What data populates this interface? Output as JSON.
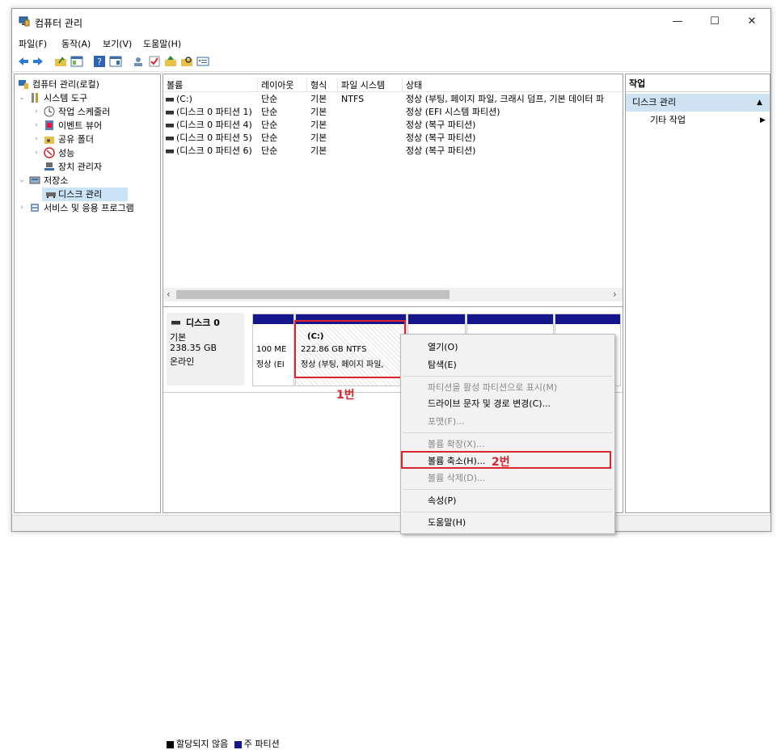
{
  "window": {
    "title": "컴퓨터 관리"
  },
  "window_controls": {
    "minimize": "—",
    "maximize": "☐",
    "close": "✕"
  },
  "menu": [
    "파일(F)",
    "동작(A)",
    "보기(V)",
    "도움말(H)"
  ],
  "toolbar_icons": [
    "back-icon",
    "forward-icon",
    "up-folder-icon",
    "show-tree-icon",
    "help-icon",
    "console-icon",
    "user-icon",
    "check-icon",
    "yellow-arrow-icon",
    "search-folder-icon",
    "properties-icon"
  ],
  "tree": [
    {
      "label": "컴퓨터 관리(로컬)",
      "icon": "computer-icon",
      "chev": ""
    },
    {
      "label": "시스템 도구",
      "icon": "tools-icon",
      "chev": "v"
    },
    {
      "label": "작업 스케줄러",
      "icon": "clock-icon",
      "chev": ">"
    },
    {
      "label": "이벤트 뷰어",
      "icon": "event-icon",
      "chev": ">"
    },
    {
      "label": "공유 폴더",
      "icon": "shared-folder-icon",
      "chev": ">"
    },
    {
      "label": "성능",
      "icon": "performance-icon",
      "chev": ">"
    },
    {
      "label": "장치 관리자",
      "icon": "device-icon",
      "chev": ""
    },
    {
      "label": "저장소",
      "icon": "storage-icon",
      "chev": "v"
    },
    {
      "label": "디스크 관리",
      "icon": "disk-icon",
      "chev": ""
    },
    {
      "label": "서비스 및 응용 프로그램",
      "icon": "services-icon",
      "chev": ">"
    }
  ],
  "columns": [
    "볼륨",
    "레이아웃",
    "형식",
    "파일 시스템",
    "상태"
  ],
  "volumes": [
    {
      "name": "(C:)",
      "layout": "단순",
      "type": "기본",
      "fs": "NTFS",
      "status": "정상 (부팅, 페이지 파일, 크래시 덤프, 기본 데이터 파"
    },
    {
      "name": "(디스크 0 파티션 1)",
      "layout": "단순",
      "type": "기본",
      "fs": "",
      "status": "정상 (EFI 시스템 파티션)"
    },
    {
      "name": "(디스크 0 파티션 4)",
      "layout": "단순",
      "type": "기본",
      "fs": "",
      "status": "정상 (복구 파티션)"
    },
    {
      "name": "(디스크 0 파티션 5)",
      "layout": "단순",
      "type": "기본",
      "fs": "",
      "status": "정상 (복구 파티션)"
    },
    {
      "name": "(디스크 0 파티션 6)",
      "layout": "단순",
      "type": "기본",
      "fs": "",
      "status": "정상 (복구 파티션)"
    }
  ],
  "scroll": {
    "left": "‹",
    "right": "›"
  },
  "disk": {
    "name": "디스크 0",
    "type": "기본",
    "size": "238.35 GB",
    "state": "온라인"
  },
  "partitions": {
    "p1": {
      "size": "100 ME",
      "status": "정상 (EI"
    },
    "c": {
      "name": "(C:)",
      "size": "222.86 GB NTFS",
      "status": "정상 (부팅, 페이지 파일,"
    }
  },
  "legend": {
    "unallocated": "할당되지 않음",
    "primary": "주 파티션"
  },
  "actions": {
    "header": "작업",
    "selected": "디스크 관리",
    "item": "기타 작업",
    "selected_arrow": "▲",
    "item_arrow": "▶"
  },
  "context_menu": {
    "open": "열기(O)",
    "explore": "탐색(E)",
    "mark_active": "파티션을 활성 파티션으로 표시(M)",
    "change_letter": "드라이브 문자 및 경로 변경(C)...",
    "format": "포맷(F)...",
    "extend": "볼륨 확장(X)...",
    "shrink": "볼륨 축소(H)...",
    "delete": "볼륨 삭제(D)...",
    "properties": "속성(P)",
    "help": "도움말(H)"
  },
  "annotations": {
    "step1": "1번",
    "step2": "2번"
  },
  "colors": {
    "primary_partition": "#16168c",
    "unallocated": "#000000",
    "highlight": "#d9252b",
    "selection": "#cfe2f4"
  }
}
